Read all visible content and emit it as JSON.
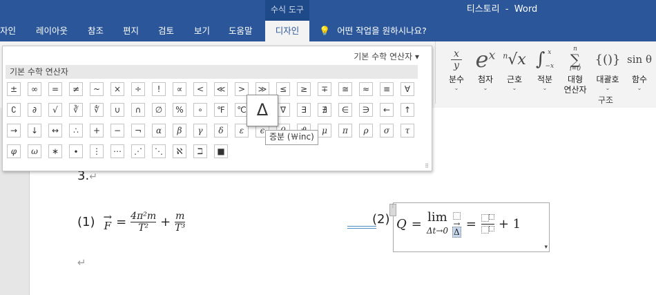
{
  "window": {
    "title": "티스토리  -  Word",
    "context_group": "수식 도구"
  },
  "tabs": [
    {
      "label": "자인"
    },
    {
      "label": "레이아웃"
    },
    {
      "label": "참조"
    },
    {
      "label": "편지"
    },
    {
      "label": "검토"
    },
    {
      "label": "보기"
    },
    {
      "label": "도움말"
    },
    {
      "label": "디자인"
    }
  ],
  "tell_me": {
    "text": "어떤 작업을 원하시나요?",
    "icon": "lightbulb-icon"
  },
  "ribbon": {
    "buttons": [
      {
        "label": "분수",
        "symbol": "x/y"
      },
      {
        "label": "첨자",
        "symbol": "eˣ"
      },
      {
        "label": "근호",
        "symbol": "ⁿ√x"
      },
      {
        "label": "적분",
        "symbol": "∫"
      },
      {
        "label": "대형",
        "label2": "연산자",
        "symbol": "∑"
      },
      {
        "label": "대괄호",
        "symbol": "{()}"
      },
      {
        "label": "함수",
        "symbol": "sin θ"
      }
    ],
    "group_label": "구조"
  },
  "gallery": {
    "title": "기본 수학 연산자",
    "category": "기본 수학 연산자",
    "symbols": [
      [
        "±",
        "∞",
        "=",
        "≠",
        "~",
        "×",
        "÷",
        "!",
        "∝",
        "<",
        "≪",
        ">",
        "≫",
        "≤",
        "≥",
        "∓",
        "≅",
        "≈",
        "≡",
        "∀"
      ],
      [
        "∁",
        "∂",
        "√",
        "∛",
        "∜",
        "∪",
        "∩",
        "∅",
        "%",
        "∘",
        "℉",
        "℃",
        "Δ",
        "∇",
        "∃",
        "∄",
        "∈",
        "∋",
        "←",
        "↑"
      ],
      [
        "→",
        "↓",
        "↔",
        "∴",
        "+",
        "−",
        "¬",
        "α",
        "β",
        "γ",
        "δ",
        "ε",
        "ϵ",
        "θ",
        "ϑ",
        "μ",
        "π",
        "ρ",
        "σ",
        "τ"
      ],
      [
        "φ",
        "ω",
        "∗",
        "∙",
        "⋮",
        "⋯",
        "⋰",
        "⋱",
        "ℵ",
        "ℶ",
        "■"
      ]
    ],
    "hovered_symbol": "Δ",
    "tooltip": "증분 (￦inc)"
  },
  "document": {
    "item_number": "3.",
    "eq1": {
      "label": "(1)",
      "lhs": "F",
      "num1": "4π²m",
      "den1": "T²",
      "num2": "m",
      "den2": "T³"
    },
    "eq2": {
      "label": "(2)",
      "var": "Q",
      "op": "lim",
      "sub": "Δt→0",
      "inserted": "Δ",
      "tail": "+ 1"
    }
  }
}
